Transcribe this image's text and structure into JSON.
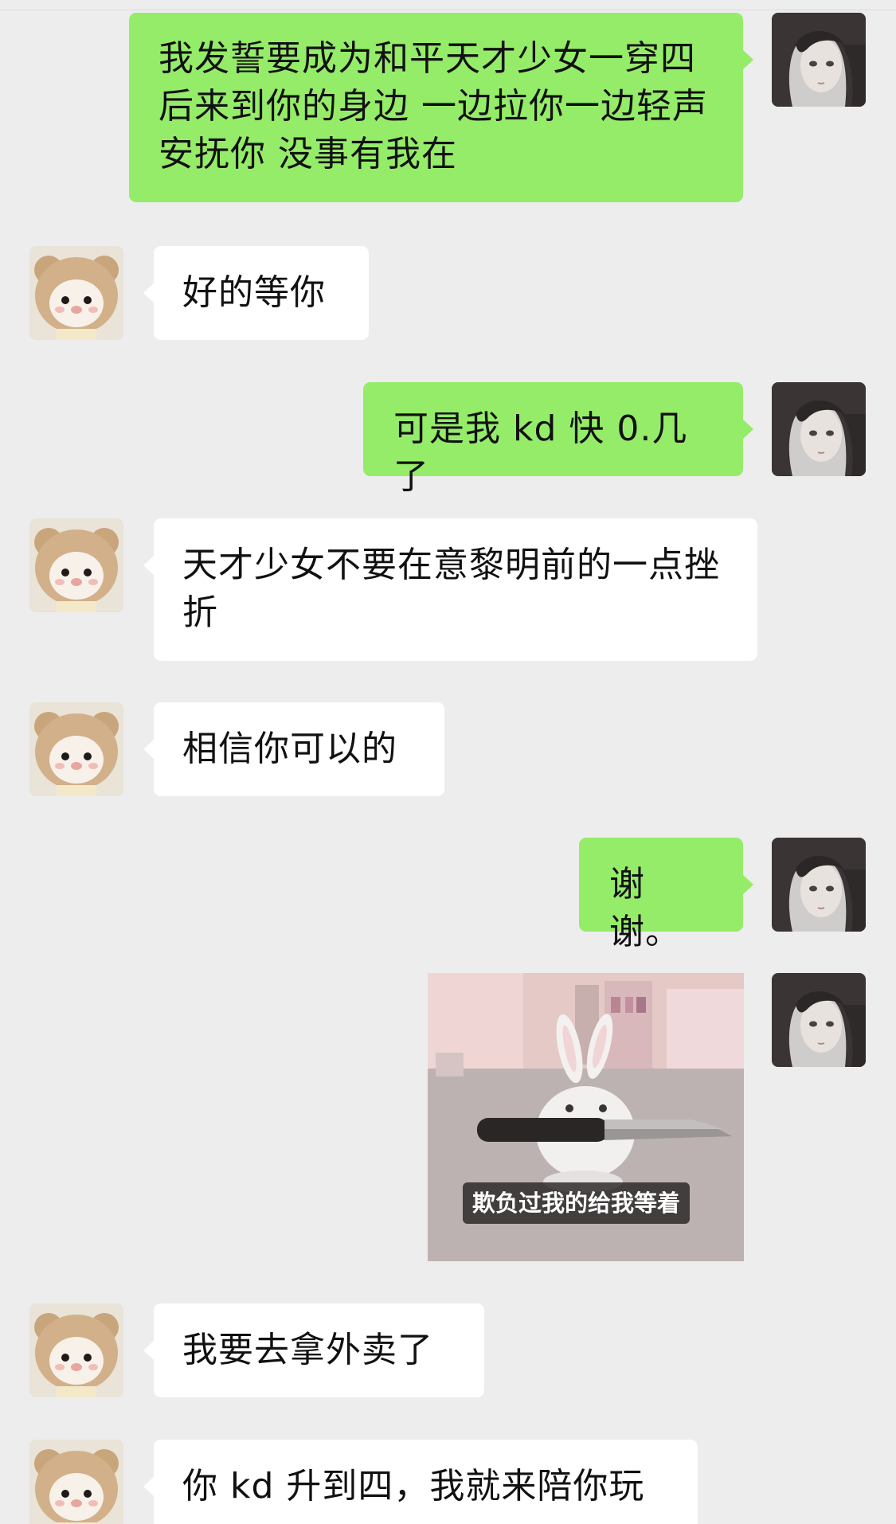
{
  "conversation": {
    "messages": [
      {
        "sender": "me",
        "type": "text",
        "text": "我发誓要成为和平天才少女一穿四后来到你的身边 一边拉你一边轻声安抚你 没事有我在"
      },
      {
        "sender": "them",
        "type": "text",
        "text": "好的等你"
      },
      {
        "sender": "me",
        "type": "text",
        "text": "可是我 kd 快 0.几了"
      },
      {
        "sender": "them",
        "type": "text",
        "text": "天才少女不要在意黎明前的一点挫折"
      },
      {
        "sender": "them",
        "type": "text",
        "text": "相信你可以的"
      },
      {
        "sender": "me",
        "type": "text",
        "text": "谢谢。"
      },
      {
        "sender": "me",
        "type": "sticker",
        "icon": "rabbit-holding-knife-sticker",
        "caption": "欺负过我的给我等着"
      },
      {
        "sender": "them",
        "type": "text",
        "text": "我要去拿外卖了"
      },
      {
        "sender": "them",
        "type": "text",
        "text": "你 kd 升到四，我就来陪你玩"
      }
    ]
  },
  "avatars": {
    "me": {
      "icon": "doll-girl-avatar-icon"
    },
    "them": {
      "icon": "plush-bear-avatar-icon"
    }
  },
  "colors": {
    "background": "#EDEDED",
    "outgoing_bubble": "#95EC69",
    "incoming_bubble": "#FFFFFF",
    "text": "#111111"
  }
}
